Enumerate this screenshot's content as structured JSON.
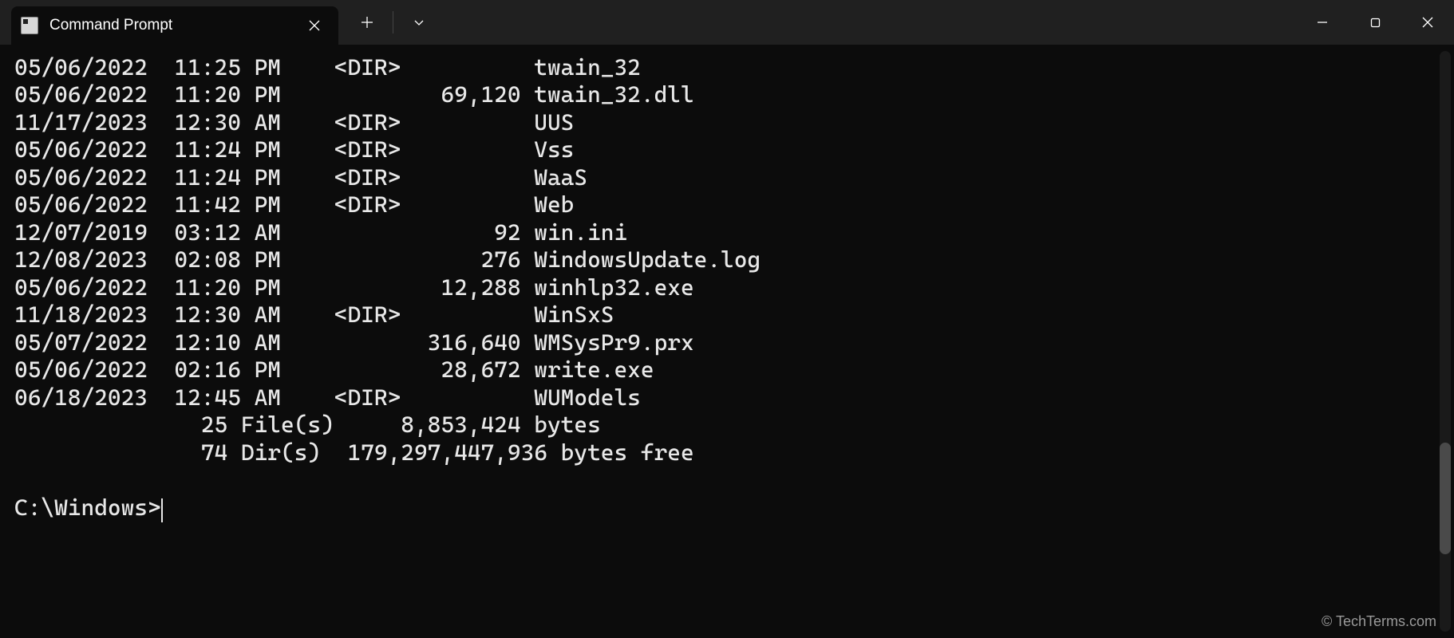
{
  "window": {
    "tab_title": "Command Prompt",
    "new_tab_label": "+",
    "dropdown_label": "⌄"
  },
  "listing": {
    "rows": [
      {
        "date": "05/06/2022",
        "time": "11:25 PM",
        "type": "<DIR>",
        "size": "",
        "name": "twain_32"
      },
      {
        "date": "05/06/2022",
        "time": "11:20 PM",
        "type": "",
        "size": "69,120",
        "name": "twain_32.dll"
      },
      {
        "date": "11/17/2023",
        "time": "12:30 AM",
        "type": "<DIR>",
        "size": "",
        "name": "UUS"
      },
      {
        "date": "05/06/2022",
        "time": "11:24 PM",
        "type": "<DIR>",
        "size": "",
        "name": "Vss"
      },
      {
        "date": "05/06/2022",
        "time": "11:24 PM",
        "type": "<DIR>",
        "size": "",
        "name": "WaaS"
      },
      {
        "date": "05/06/2022",
        "time": "11:42 PM",
        "type": "<DIR>",
        "size": "",
        "name": "Web"
      },
      {
        "date": "12/07/2019",
        "time": "03:12 AM",
        "type": "",
        "size": "92",
        "name": "win.ini"
      },
      {
        "date": "12/08/2023",
        "time": "02:08 PM",
        "type": "",
        "size": "276",
        "name": "WindowsUpdate.log"
      },
      {
        "date": "05/06/2022",
        "time": "11:20 PM",
        "type": "",
        "size": "12,288",
        "name": "winhlp32.exe"
      },
      {
        "date": "11/18/2023",
        "time": "12:30 AM",
        "type": "<DIR>",
        "size": "",
        "name": "WinSxS"
      },
      {
        "date": "05/07/2022",
        "time": "12:10 AM",
        "type": "",
        "size": "316,640",
        "name": "WMSysPr9.prx"
      },
      {
        "date": "05/06/2022",
        "time": "02:16 PM",
        "type": "",
        "size": "28,672",
        "name": "write.exe"
      },
      {
        "date": "06/18/2023",
        "time": "12:45 AM",
        "type": "<DIR>",
        "size": "",
        "name": "WUModels"
      }
    ],
    "summary": {
      "file_count": "25",
      "file_label": "File(s)",
      "file_bytes": "8,853,424",
      "bytes_label": "bytes",
      "dir_count": "74",
      "dir_label": "Dir(s)",
      "free_bytes": "179,297,447,936",
      "free_label": "bytes free"
    }
  },
  "prompt": "C:\\Windows>",
  "watermark": "© TechTerms.com"
}
